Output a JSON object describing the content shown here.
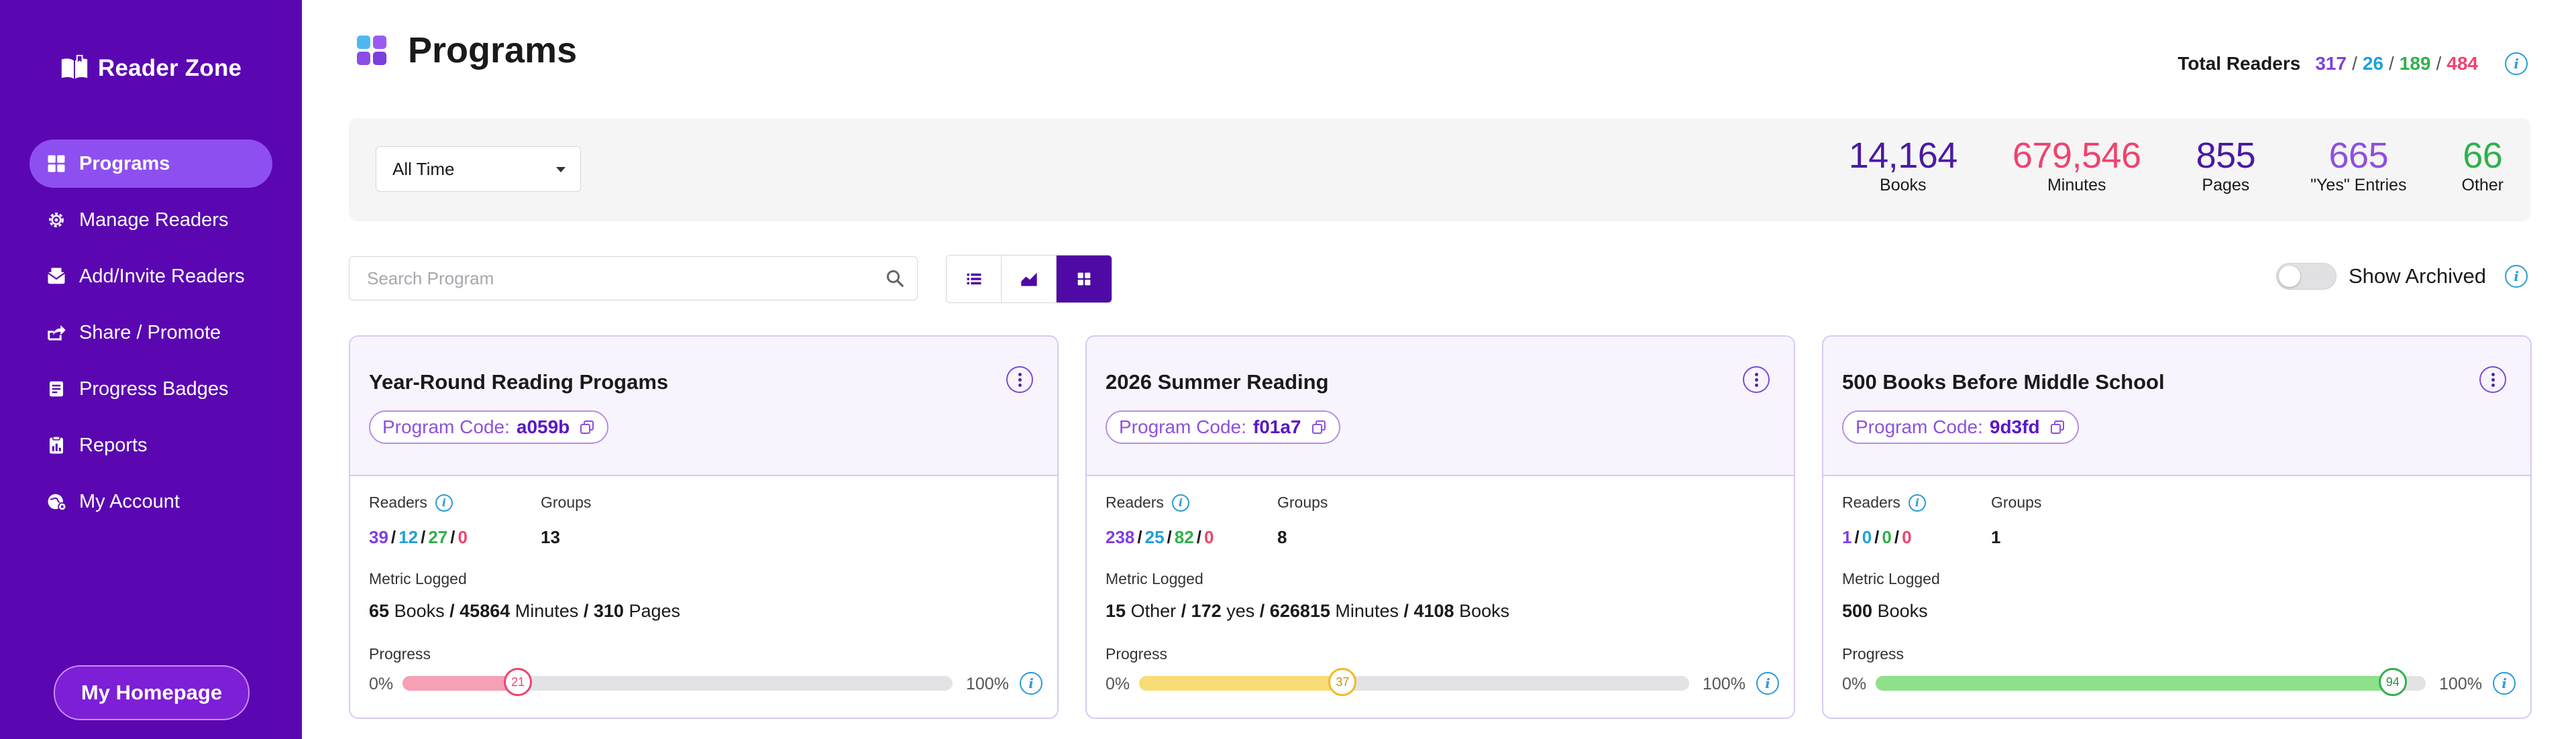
{
  "app": {
    "name": "Reader Zone"
  },
  "sidebar": {
    "items": [
      {
        "label": "Programs",
        "icon": "grid-icon",
        "active": true
      },
      {
        "label": "Manage Readers",
        "icon": "gear-icon"
      },
      {
        "label": "Add/Invite Readers",
        "icon": "envelope-icon"
      },
      {
        "label": "Share / Promote",
        "icon": "share-icon"
      },
      {
        "label": "Progress Badges",
        "icon": "badge-icon"
      },
      {
        "label": "Reports",
        "icon": "report-icon"
      },
      {
        "label": "My Account",
        "icon": "account-icon"
      }
    ],
    "home_button": "My Homepage"
  },
  "header": {
    "title": "Programs",
    "total_readers": {
      "label": "Total Readers",
      "values": [
        "317",
        "26",
        "189",
        "484"
      ]
    }
  },
  "filters": {
    "time_range": "All Time"
  },
  "stats": [
    {
      "value": "14,164",
      "label": "Books",
      "color": "#4a1aa0"
    },
    {
      "value": "679,546",
      "label": "Minutes",
      "color": "#f0436c"
    },
    {
      "value": "855",
      "label": "Pages",
      "color": "#4a1aa0"
    },
    {
      "value": "665",
      "label": "\"Yes\" Entries",
      "color": "#8e50e0"
    },
    {
      "value": "66",
      "label": "Other",
      "color": "#2fb14a"
    }
  ],
  "search": {
    "placeholder": "Search Program",
    "value": ""
  },
  "view_modes": [
    "list",
    "chart",
    "grid"
  ],
  "active_view": "grid",
  "archived": {
    "label": "Show Archived",
    "on": false
  },
  "labels": {
    "program_code": "Program Code:",
    "readers": "Readers",
    "groups": "Groups",
    "metric_logged": "Metric Logged",
    "progress": "Progress",
    "zero": "0%",
    "hundred": "100%"
  },
  "programs": [
    {
      "title": "Year-Round Reading Progams",
      "code": "a059b",
      "readers": [
        "39",
        "12",
        "27",
        "0"
      ],
      "groups": "13",
      "metric": [
        {
          "n": "65",
          "unit": "Books"
        },
        {
          "n": "45864",
          "unit": "Minutes"
        },
        {
          "n": "310",
          "unit": "Pages"
        }
      ],
      "progress": 21,
      "progress_label": "21",
      "progress_color": "#f5a0b4",
      "progress_ring": "#f0436c",
      "progress_text": "#f0436c"
    },
    {
      "title": "2026 Summer Reading",
      "code": "f01a7",
      "readers": [
        "238",
        "25",
        "82",
        "0"
      ],
      "groups": "8",
      "metric": [
        {
          "n": "15",
          "unit": "Other"
        },
        {
          "n": "172",
          "unit": "yes"
        },
        {
          "n": "626815",
          "unit": "Minutes"
        },
        {
          "n": "4108",
          "unit": "Books"
        }
      ],
      "progress": 37,
      "progress_label": "37",
      "progress_color": "#f8dc78",
      "progress_ring": "#f2b826",
      "progress_text": "#c89000"
    },
    {
      "title": "500 Books Before Middle School",
      "code": "9d3fd",
      "readers": [
        "1",
        "0",
        "0",
        "0"
      ],
      "groups": "1",
      "metric": [
        {
          "n": "500",
          "unit": "Books"
        }
      ],
      "progress": 94,
      "progress_label": "94",
      "progress_color": "#8ee08a",
      "progress_ring": "#2fb14a",
      "progress_text": "#2f8a3e"
    }
  ]
}
